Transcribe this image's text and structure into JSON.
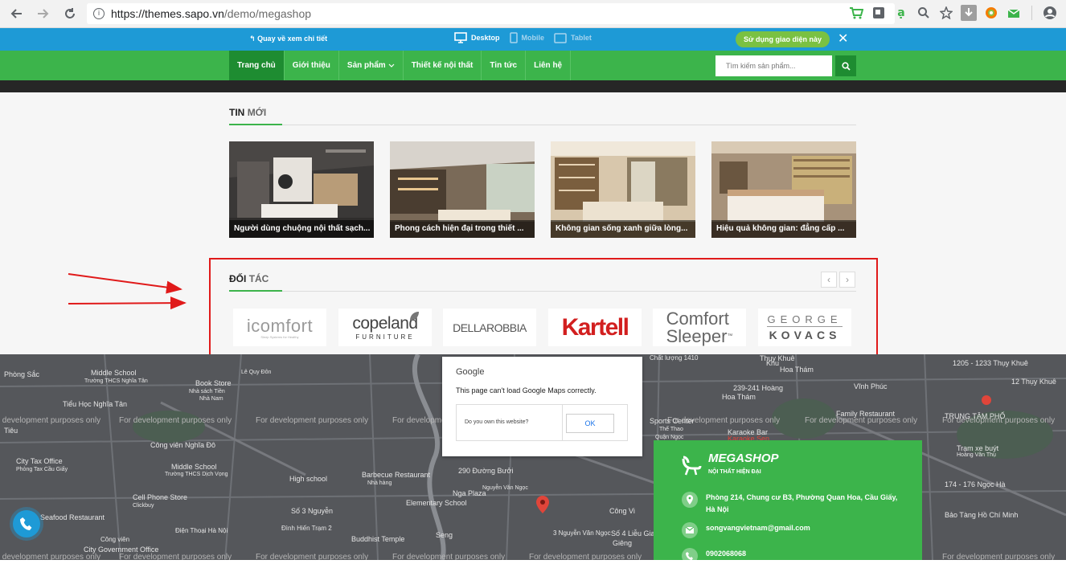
{
  "browser": {
    "url_host": "https://themes.sapo.vn",
    "url_path": "/demo/megashop"
  },
  "demo_bar": {
    "back_label": "Quay về xem chi tiết",
    "devices": [
      "Desktop",
      "Mobile",
      "Tablet"
    ],
    "use_theme_label": "Sử dụng giao diện này"
  },
  "nav": {
    "items": [
      "Trang chủ",
      "Giới thiệu",
      "Sản phẩm",
      "Thiết kế nội thất",
      "Tin tức",
      "Liên hệ"
    ],
    "search_placeholder": "Tìm kiếm sản phẩm..."
  },
  "news": {
    "title_bold": "TIN",
    "title_light": "MỚI",
    "items": [
      "Người dùng chuộng nội thất sạch...",
      "Phong cách hiện đại trong thiết ...",
      "Không gian sống xanh giữa lòng...",
      "Hiệu quả không gian: đẳng cấp ..."
    ]
  },
  "partners": {
    "title_bold": "ĐỐI",
    "title_light": "TÁC",
    "prev": "‹",
    "next": "›",
    "logos": {
      "icomfort": "icomfort",
      "icomfort_tag": "Sleep Systems for Healthy",
      "copeland": "copeland",
      "copeland_sub": "FURNITURE",
      "dellarobbia": "DELLAROBBIA",
      "kartell": "Kartell",
      "comfort1": "Comfort",
      "comfort2": "Sleeper",
      "comfort_tm": "™",
      "george": "GEORGE",
      "kovacs": "KOVACS"
    }
  },
  "map": {
    "dev_text": "For development purposes only",
    "labels": [
      "Middle School",
      "Trường THCS Nghĩa Tân",
      "Lê Quy Đôn",
      "Book Store",
      "Nhà sách Tiền",
      "Nhà Nam",
      "Công viên Nghĩa Đô",
      "City Tax Office",
      "Phòng Tax Cầu Giấy",
      "Middle School",
      "Trường THCS Dịch Vọng",
      "High school",
      "Barbecue Restaurant",
      "Nhà hàng",
      "Elementary School",
      "Nga Plaza",
      "290 Đường Bưởi",
      "Nguyễn Văn Ngọc",
      "Số 3 Nguyễn",
      "Đình Hiến Trạm 2",
      "Buddhist Temple",
      "Cell Phone Store",
      "Clickbuy",
      "Seafood Restaurant",
      "City Government Office",
      "Điện Thoại Hà Nội",
      "Tiểu Học Nghĩa Tân",
      "Phòng Sắc",
      "Tiêu",
      "Sports Center",
      "Thể Thao",
      "Quận Ngọc",
      "Karaoke Bar",
      "Karaoke Sen",
      "Vĩnh Phúc",
      "Family Restaurant",
      "TRUNG TÂM PHỐ",
      "174 - 176 Ngọc Hà",
      "Bảo Tàng Hồ Chí Minh",
      "12 Thụy Khuê",
      "Trạm xe buýt",
      "Hoàng Văn Thụ",
      "1205 - 1233 Thụy Khuê",
      "Thụy Khuê",
      "Hoa Thám",
      "Chất lượng 1410",
      "239-241 Hoàng",
      "Hoa Thám",
      "Công Vi",
      "Số 4 Liễu Giai",
      "Giêng",
      "3 Nguyễn Văn Ngọc",
      "Công viên",
      "Seng",
      "Khu"
    ]
  },
  "google_dialog": {
    "brand": "Google",
    "message": "This page can't load Google Maps correctly.",
    "question": "Do you own this website?",
    "ok": "OK"
  },
  "footer": {
    "brand": "MEGASHOP",
    "slogan": "NỘI THẤT HIỆN ĐẠI",
    "address_line1": "Phòng 214, Chung cư B3, Phường Quan Hoa, Cầu Giấy,",
    "address_line2": "Hà Nội",
    "email": "songvangvietnam@gmail.com",
    "phone": "0902068068"
  },
  "colors": {
    "green": "#3cb44b",
    "dark_green": "#1e8c31",
    "blue": "#1e9ad6",
    "red_annotation": "#e01a1a"
  }
}
